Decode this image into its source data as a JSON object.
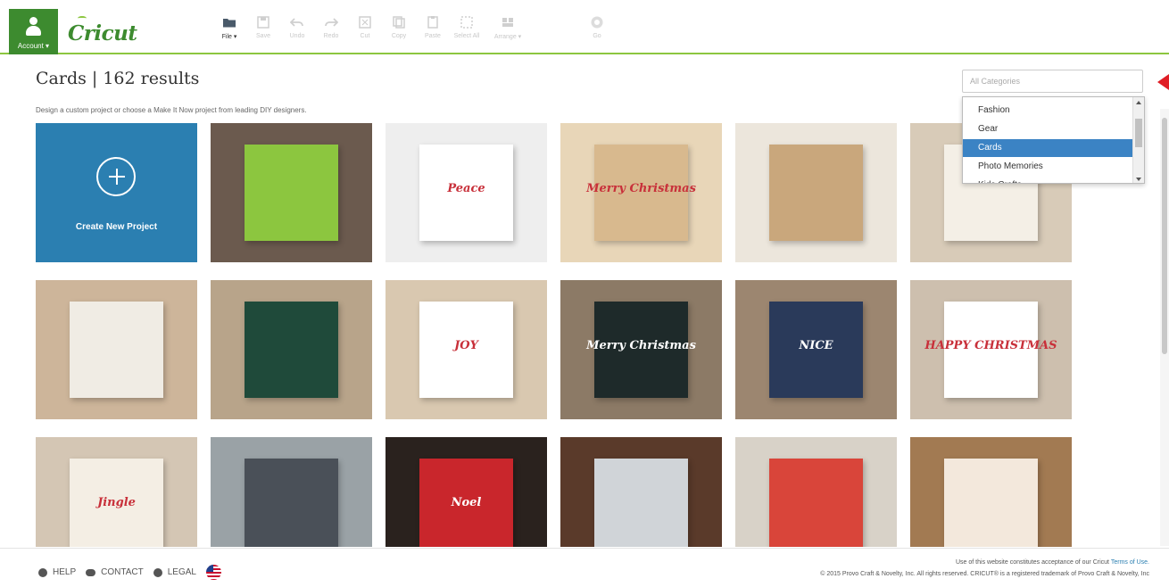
{
  "app": {
    "account_label": "Account ▾",
    "logo_text": "Cricut",
    "toolbar": [
      {
        "label": "File ▾",
        "icon": "folder-icon",
        "active": true
      },
      {
        "label": "Save",
        "icon": "save-icon",
        "active": false
      },
      {
        "label": "Undo",
        "icon": "undo-icon",
        "active": false
      },
      {
        "label": "Redo",
        "icon": "redo-icon",
        "active": false
      },
      {
        "label": "Cut",
        "icon": "cut-icon",
        "active": false
      },
      {
        "label": "Copy",
        "icon": "copy-icon",
        "active": false
      },
      {
        "label": "Paste",
        "icon": "paste-icon",
        "active": false
      },
      {
        "label": "Select All",
        "icon": "select-all-icon",
        "active": false
      },
      {
        "label": "Arrange ▾",
        "icon": "arrange-icon",
        "active": false
      },
      {
        "label": "Go",
        "icon": "go-icon",
        "active": false
      }
    ]
  },
  "header": {
    "title": "Cards | 162 results",
    "subtitle": "Design a custom project or choose a Make It Now project from leading DIY designers."
  },
  "category_filter": {
    "placeholder": "All Categories",
    "options": [
      "Fashion",
      "Gear",
      "Cards",
      "Photo Memories",
      "Kids Crafts"
    ],
    "selected": "Cards"
  },
  "grid": {
    "create_label": "Create New Project",
    "tiles": [
      {
        "name": "partridge-pear-tree-card",
        "bg": "#6b5a4e",
        "card": "#8cc63f",
        "text": ""
      },
      {
        "name": "peace-wreath-card",
        "bg": "#eeeeee",
        "card": "#ffffff",
        "text": "Peace"
      },
      {
        "name": "merry-christmas-holly-card",
        "bg": "#e8d6b8",
        "card": "#d8b98e",
        "text": "Merry Christmas"
      },
      {
        "name": "christmas-tree-cards",
        "bg": "#ece6dc",
        "card": "#c9a77c",
        "text": ""
      },
      {
        "name": "christmas-cards-set",
        "bg": "#d8cbb8",
        "card": "#f4efe6",
        "text": ""
      },
      {
        "name": "polar-bear-gift-tag",
        "bg": "#cdb59a",
        "card": "#f0ece4",
        "text": ""
      },
      {
        "name": "woodland-deer-card",
        "bg": "#b8a48a",
        "card": "#1f4a3a",
        "text": ""
      },
      {
        "name": "joy-wreath-cards",
        "bg": "#d9c8b0",
        "card": "#ffffff",
        "text": "JOY"
      },
      {
        "name": "merry-christmas-chalk-card",
        "bg": "#8c7a66",
        "card": "#1e2a2a",
        "text": "Merry Christmas"
      },
      {
        "name": "nice-gift-tags",
        "bg": "#9c8670",
        "card": "#2a3a5a",
        "text": "NICE"
      },
      {
        "name": "happy-christmas-card",
        "bg": "#cdbfae",
        "card": "#ffffff",
        "text": "HAPPY CHRISTMAS"
      },
      {
        "name": "jingle-popup-card",
        "bg": "#d4c6b4",
        "card": "#f4eee4",
        "text": "Jingle"
      },
      {
        "name": "teapot-shelf-cards",
        "bg": "#9aa2a6",
        "card": "#4a5058",
        "text": ""
      },
      {
        "name": "noel-popup-card",
        "bg": "#2a221e",
        "card": "#c9262c",
        "text": "Noel"
      },
      {
        "name": "lace-doily-card",
        "bg": "#5a3a2a",
        "card": "#d0d4d8",
        "text": ""
      },
      {
        "name": "red-green-tree-card",
        "bg": "#d8d2c8",
        "card": "#d9453a",
        "text": ""
      },
      {
        "name": "ornament-gift-tag",
        "bg": "#a27a52",
        "card": "#f3e8dc",
        "text": ""
      }
    ]
  },
  "footer": {
    "help": "HELP",
    "contact": "CONTACT",
    "legal": "LEGAL",
    "terms_line": "Use of this website constitutes acceptance of our Cricut",
    "terms_link": "Terms of Use.",
    "copyright": "© 2015 Provo Craft & Novelty, Inc. All rights reserved. CRICUT® is a registered trademark of Provo Craft & Novelty, Inc"
  }
}
